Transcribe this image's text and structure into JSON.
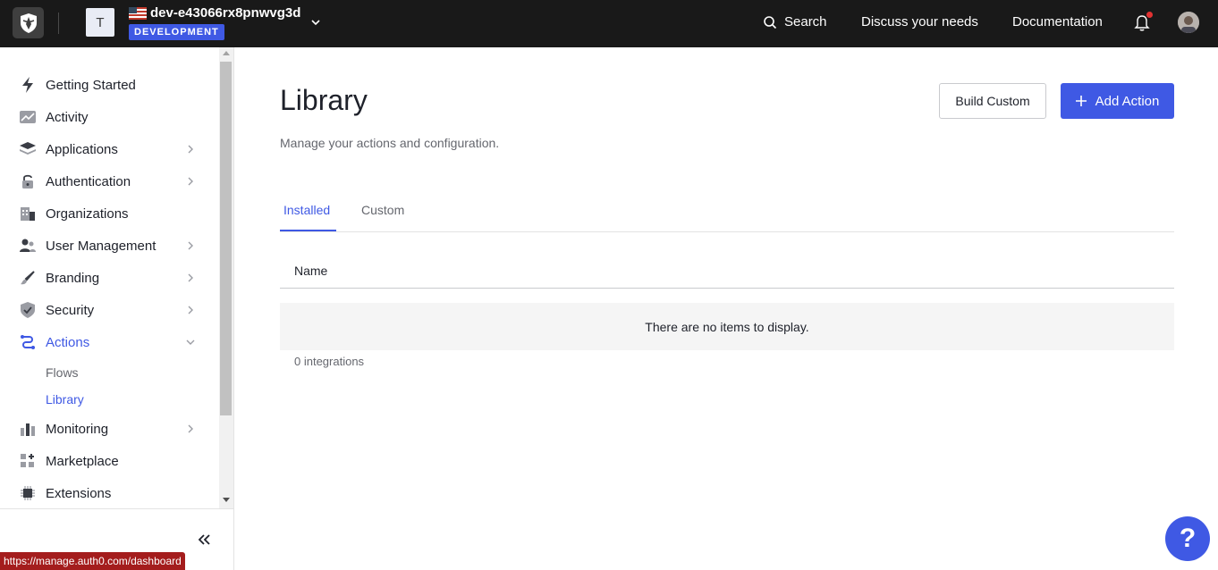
{
  "topbar": {
    "tenant_initial": "T",
    "tenant_name": "dev-e43066rx8pnwvg3d",
    "environment": "DEVELOPMENT",
    "search_label": "Search",
    "discuss_label": "Discuss your needs",
    "docs_label": "Documentation",
    "accent": "#3f59e4",
    "bg": "#191919"
  },
  "sidebar": {
    "items": [
      {
        "label": "Getting Started",
        "icon": "bolt-icon"
      },
      {
        "label": "Activity",
        "icon": "activity-chart-icon"
      },
      {
        "label": "Applications",
        "icon": "layers-icon"
      },
      {
        "label": "Authentication",
        "icon": "lock-icon"
      },
      {
        "label": "Organizations",
        "icon": "building-icon"
      },
      {
        "label": "User Management",
        "icon": "users-icon"
      },
      {
        "label": "Branding",
        "icon": "brush-icon"
      },
      {
        "label": "Security",
        "icon": "shield-icon"
      },
      {
        "label": "Actions",
        "icon": "actions-icon"
      },
      {
        "label": "Monitoring",
        "icon": "bar-chart-icon"
      },
      {
        "label": "Marketplace",
        "icon": "grid-plus-icon"
      },
      {
        "label": "Extensions",
        "icon": "chip-icon"
      }
    ],
    "actions_sub": {
      "flows": "Flows",
      "library": "Library"
    },
    "status_url": "https://manage.auth0.com/dashboard"
  },
  "main": {
    "title": "Library",
    "subtitle": "Manage your actions and configuration.",
    "build_custom_label": "Build Custom",
    "add_action_label": "Add Action",
    "tabs": [
      {
        "label": "Installed",
        "active": true
      },
      {
        "label": "Custom",
        "active": false
      }
    ],
    "table": {
      "column_name": "Name",
      "empty_message": "There are no items to display.",
      "count_text": "0 integrations"
    },
    "help_label": "?"
  }
}
